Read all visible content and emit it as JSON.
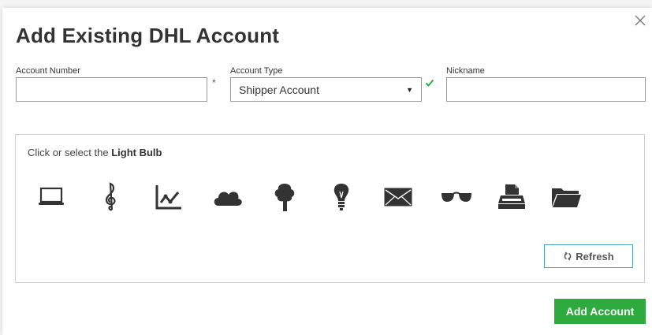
{
  "modal": {
    "title": "Add Existing DHL Account",
    "close_icon": "close-icon"
  },
  "form": {
    "account_number": {
      "label": "Account Number",
      "value": "",
      "required_mark": "*"
    },
    "account_type": {
      "label": "Account Type",
      "selected": "Shipper Account",
      "valid_icon": "check-icon"
    },
    "nickname": {
      "label": "Nickname",
      "value": ""
    }
  },
  "captcha": {
    "prompt_prefix": "Click or select the ",
    "prompt_target": "Light Bulb",
    "icons": [
      "laptop-icon",
      "treble-clef-icon",
      "chart-icon",
      "cloud-icon",
      "tree-icon",
      "light-bulb-icon",
      "envelope-icon",
      "sunglasses-icon",
      "printer-icon",
      "folder-icon"
    ],
    "refresh_label": "Refresh"
  },
  "actions": {
    "add_account_label": "Add Account"
  },
  "colors": {
    "primary_green": "#2eab3e",
    "refresh_border": "#4aa6c3",
    "icon_gray": "#333333"
  }
}
